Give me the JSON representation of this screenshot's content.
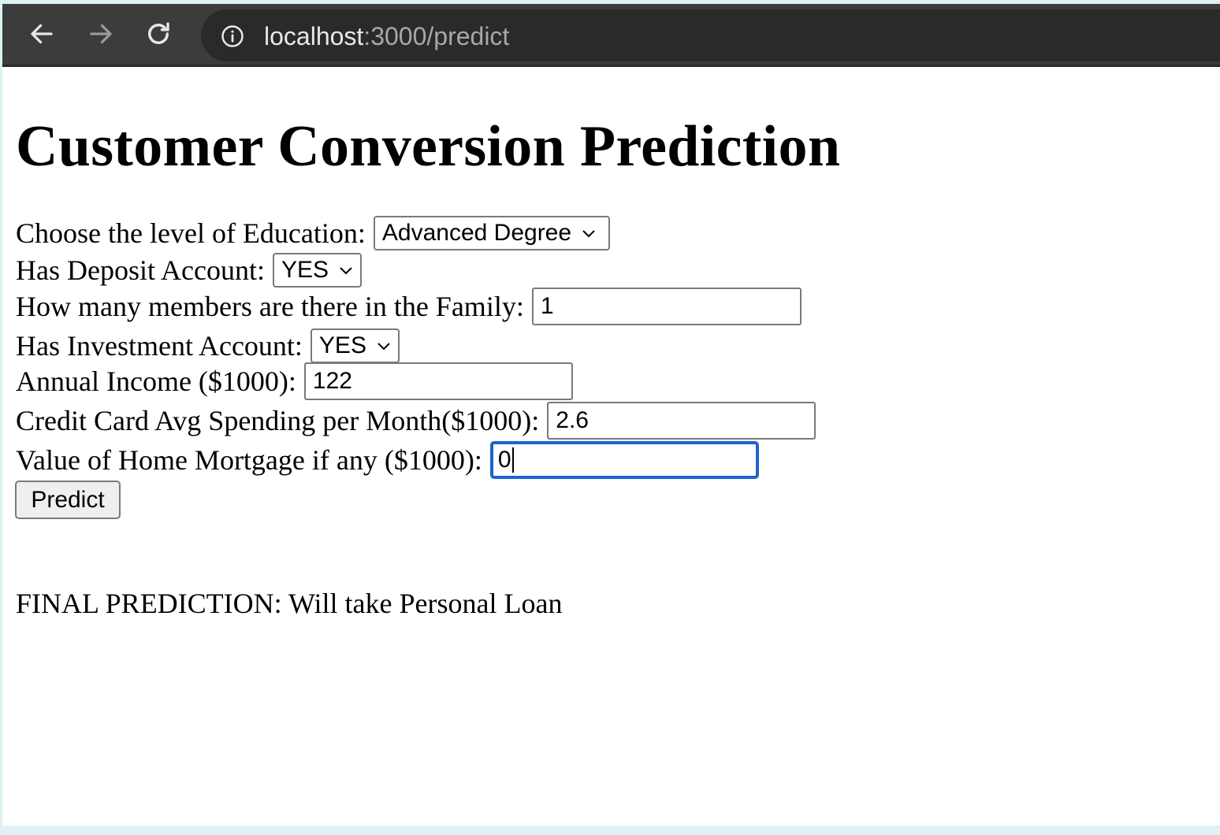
{
  "browser": {
    "url_host": "localhost",
    "url_path": ":3000/predict"
  },
  "page": {
    "title": "Customer Conversion Prediction",
    "form": {
      "education": {
        "label": "Choose the level of Education:",
        "selected": "Advanced Degree"
      },
      "deposit": {
        "label": "Has Deposit Account:",
        "selected": "YES"
      },
      "family": {
        "label": "How many members are there in the Family:",
        "value": "1"
      },
      "investment": {
        "label": "Has Investment Account:",
        "selected": "YES"
      },
      "income": {
        "label": "Annual Income ($1000):",
        "value": "122"
      },
      "ccavg": {
        "label": "Credit Card Avg Spending per Month($1000):",
        "value": "2.6"
      },
      "mortgage": {
        "label": "Value of Home Mortgage if any ($1000):",
        "value": "0"
      },
      "submit_label": "Predict"
    },
    "result": "FINAL PREDICTION: Will take Personal Loan"
  },
  "icons": {
    "back": "back-arrow-icon",
    "forward": "forward-arrow-icon",
    "reload": "reload-icon",
    "info": "info-icon",
    "dropdown": "chevron-down-icon"
  },
  "colors": {
    "focus_ring": "#1c63cf",
    "chrome_bg": "#3c3c3c",
    "address_bg": "#2a2a2a"
  }
}
